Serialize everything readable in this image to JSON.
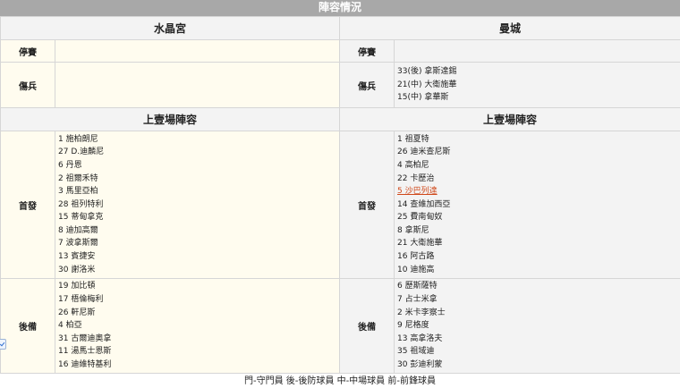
{
  "page_title": "陣容情況",
  "teams": {
    "home": "水晶宮",
    "away": "曼城"
  },
  "labels": {
    "suspended": "停賽",
    "injured": "傷兵",
    "last_lineup": "上壹場陣容",
    "starting": "首發",
    "bench": "後備"
  },
  "home": {
    "suspended": [],
    "injured": [],
    "starting": [
      "1 施柏朗尼",
      "27 D.迪麟尼",
      "6 丹恩",
      "2 祖爾禾特",
      "3 馬里亞柏",
      "28 祖列特利",
      "15 蒂甸拿克",
      "8 迪加高爾",
      "7 波拿斯爾",
      "13 賓捷安",
      "30 謝洛米"
    ],
    "bench": [
      "19 加比頓",
      "17 梧倫梅利",
      "26 軒尼斯",
      "4 柏亞",
      "31 古爾迪奧拿",
      "11 湯馬士恩斯",
      "16 迪維特基利"
    ]
  },
  "away": {
    "suspended": [],
    "injured": [
      "33(後) 拿斯達錫",
      "21(中) 大衛施華",
      "15(中) 拿華斯"
    ],
    "starting": [
      "1 祖夏特",
      "26 迪米查尼斯",
      "4 高柏尼",
      "22 卡歷治",
      "5 沙巴列達",
      "14 查維加西亞",
      "25 費南甸奴",
      "8 拿斯尼",
      "21 大衛施華",
      "16 阿古路",
      "10 迪施高"
    ],
    "starting_highlight_index": 4,
    "bench": [
      "6 歷斯薩特",
      "7 占士米拿",
      "2 米卡李察士",
      "9 尼格度",
      "13 高拿洛夫",
      "35 祖域迪",
      "30 彭迪利蒙"
    ]
  },
  "footnote": "門-守門員 後-後防球員 中-中場球員 前-前鋒球員"
}
